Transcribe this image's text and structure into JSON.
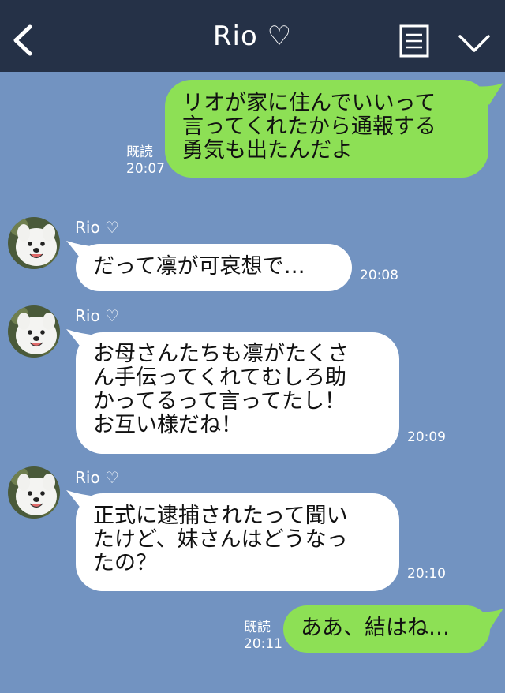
{
  "header": {
    "title": "Rio ♡",
    "back_icon": "chevron-left-icon",
    "menu_icon": "note-list-icon",
    "expand_icon": "chevron-down-icon",
    "background": "#253147"
  },
  "colors": {
    "chat_background": "#7293c1",
    "sent_bubble": "#8de055",
    "received_bubble": "#ffffff"
  },
  "messages": [
    {
      "direction": "sent",
      "text": "リオが家に住んでいいって\n言ってくれたから通報する\n勇気も出たんだよ",
      "read": "既読",
      "time": "20:07"
    },
    {
      "direction": "received",
      "sender": "Rio ♡",
      "text": "だって凛が可哀想で…",
      "time": "20:08"
    },
    {
      "direction": "received",
      "sender": "Rio ♡",
      "text": "お母さんたちも凛がたくさ\nん手伝ってくれてむしろ助\nかってるって言ってたし！\nお互い様だね！",
      "time": "20:09"
    },
    {
      "direction": "received",
      "sender": "Rio ♡",
      "text": "正式に逮捕されたって聞い\nたけど、妹さんはどうなっ\nたの？",
      "time": "20:10"
    },
    {
      "direction": "sent",
      "text": "ああ、結はね…",
      "read": "既読",
      "time": "20:11"
    }
  ]
}
